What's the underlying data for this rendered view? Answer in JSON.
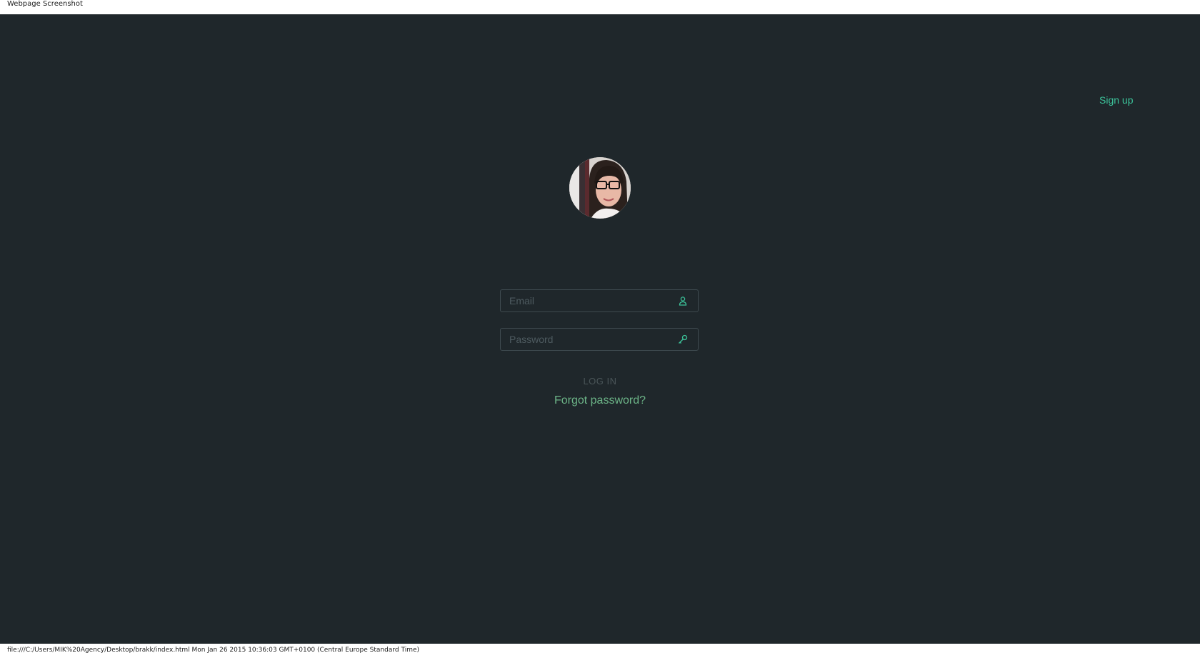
{
  "window": {
    "caption": "Webpage Screenshot"
  },
  "header": {
    "signup_label": "Sign up"
  },
  "login_form": {
    "email_placeholder": "Email",
    "password_placeholder": "Password",
    "login_label": "LOG IN",
    "forgot_label": "Forgot password?",
    "email_icon": "user-icon",
    "password_icon": "key-icon"
  },
  "status_bar": {
    "text": "file:///C:/Users/MIK%20Agency/Desktop/brakk/index.html Mon Jan 26 2015 10:36:03 GMT+0100 (Central Europe Standard Time)"
  },
  "colors": {
    "background": "#1f272b",
    "accent": "#3cc39a",
    "forgot_link": "#6cb487",
    "field_border": "#3e4a4f"
  }
}
